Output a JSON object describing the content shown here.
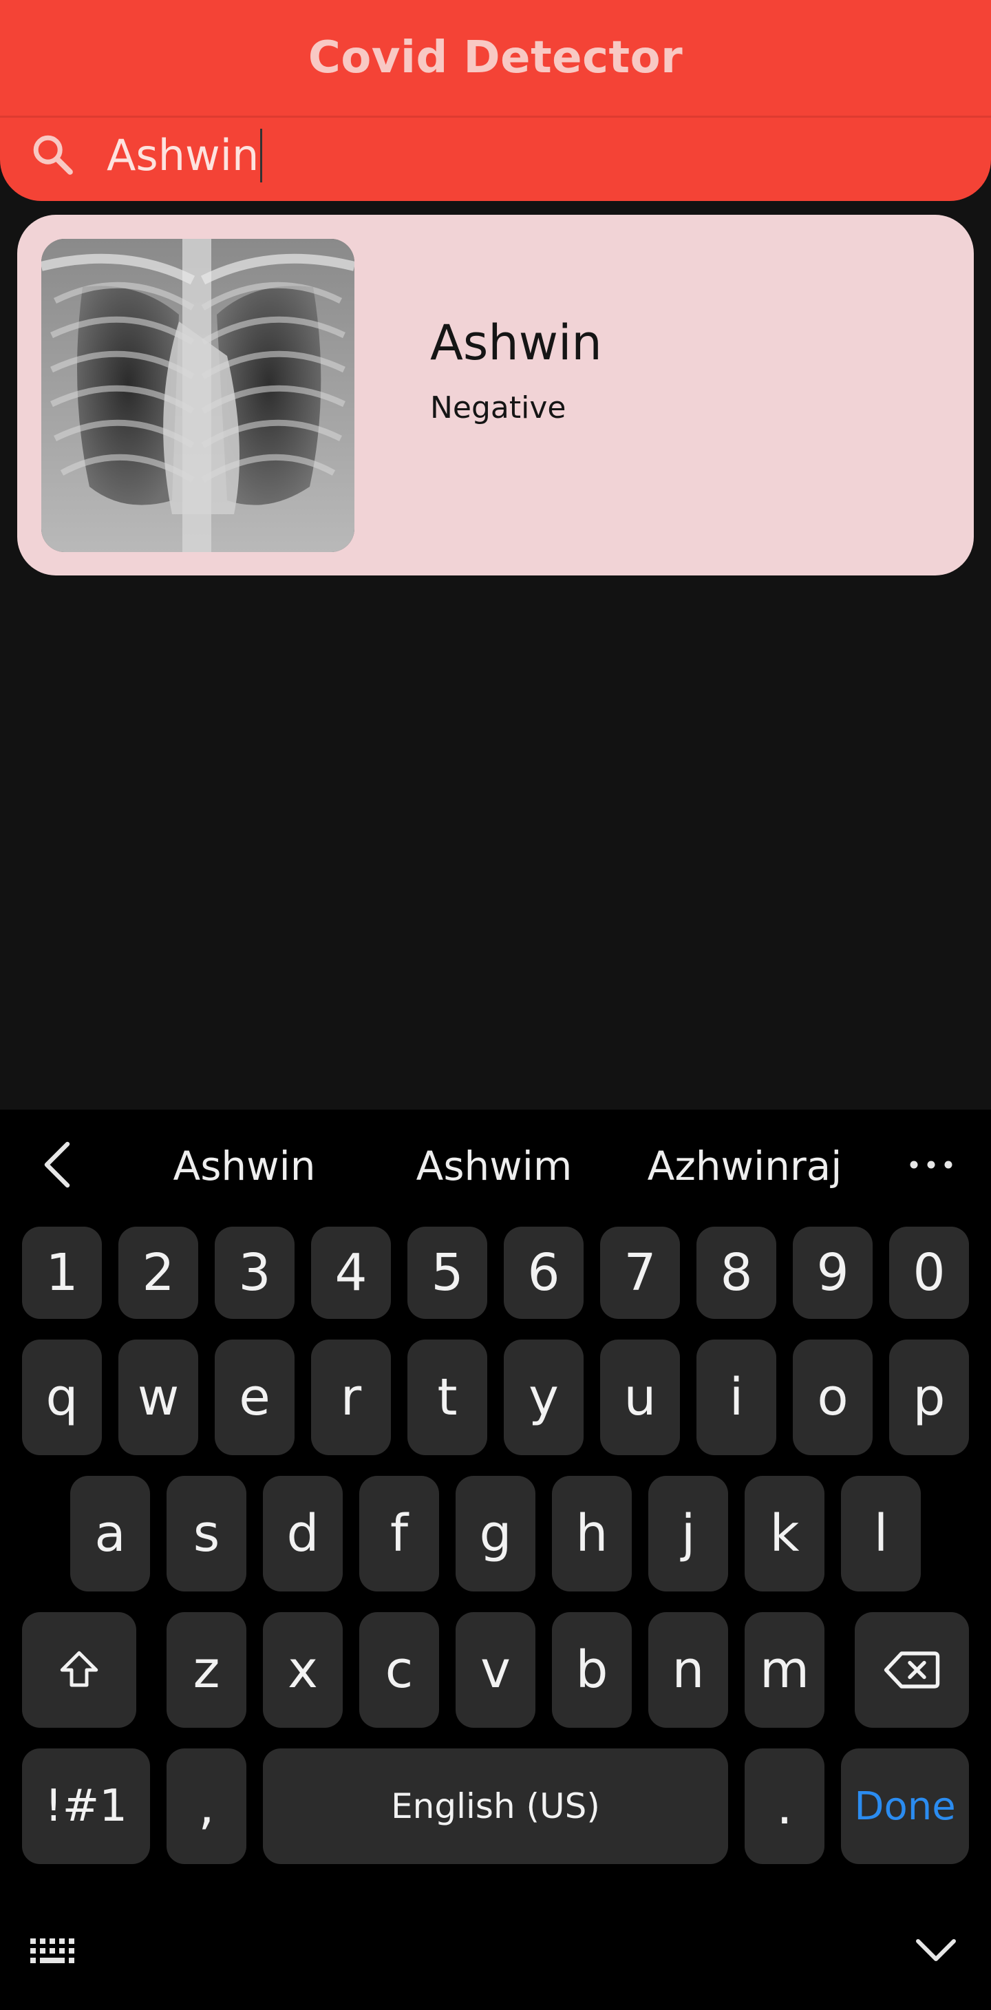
{
  "app": {
    "title": "Covid Detector"
  },
  "search": {
    "value": "Ashwin"
  },
  "results": [
    {
      "name": "Ashwin",
      "status": "Negative",
      "image": "chest-xray"
    }
  ],
  "keyboard": {
    "suggestions": [
      "Ashwin",
      "Ashwim",
      "Azhwinraj"
    ],
    "number_row": [
      "1",
      "2",
      "3",
      "4",
      "5",
      "6",
      "7",
      "8",
      "9",
      "0"
    ],
    "row1": [
      "q",
      "w",
      "e",
      "r",
      "t",
      "y",
      "u",
      "i",
      "o",
      "p"
    ],
    "row2": [
      "a",
      "s",
      "d",
      "f",
      "g",
      "h",
      "j",
      "k",
      "l"
    ],
    "row3": [
      "z",
      "x",
      "c",
      "v",
      "b",
      "n",
      "m"
    ],
    "symbols_label": "!#1",
    "comma_label": ",",
    "space_label": "English (US)",
    "period_label": ".",
    "done_label": "Done",
    "icons": [
      "chevron-left-icon",
      "more-icon",
      "shift-icon",
      "backspace-icon",
      "keyboard-icon",
      "chevron-down-icon"
    ]
  },
  "colors": {
    "appbar": "#f44336",
    "title": "#f8c9c4",
    "card": "#f1d3d6",
    "background": "#121212",
    "key": "#2c2c2c",
    "done": "#2b8cf0"
  }
}
